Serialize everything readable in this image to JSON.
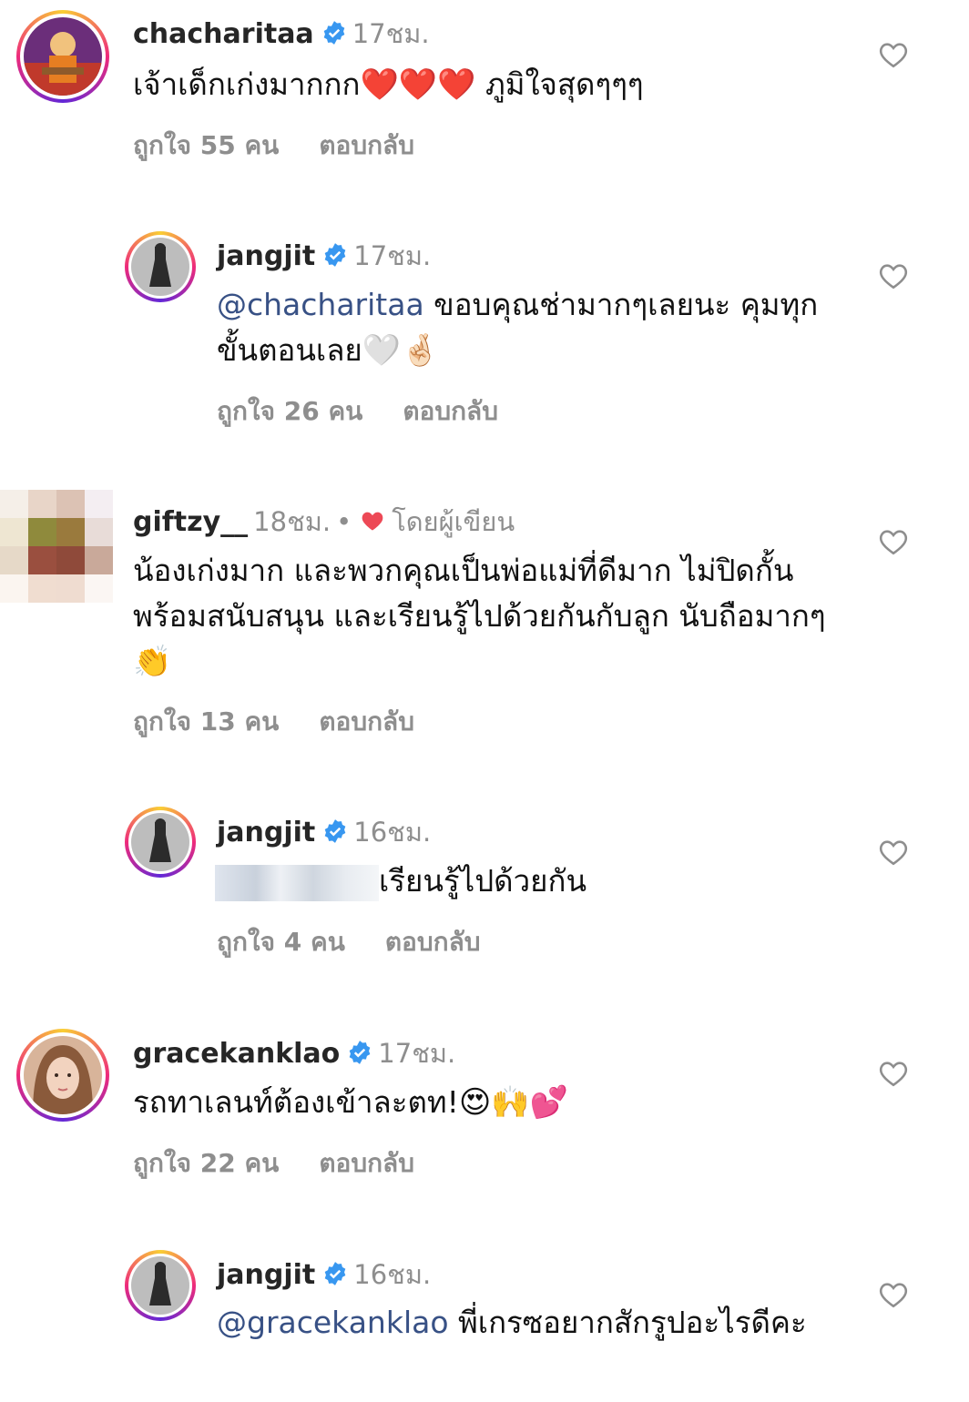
{
  "comments": [
    {
      "user": "chacharitaa",
      "time": "17ชม.",
      "text": "เจ้าเด็กเก่งมากกก",
      "emoji": "❤️❤️❤️",
      "text2": " ภูมิใจสุดๆๆๆ",
      "likes": "ถูกใจ 55 คน",
      "reply": "ตอบกลับ"
    },
    {
      "user": "jangjit",
      "time": "17ชม.",
      "mention": "@chacharitaa",
      "text": " ขอบคุณช่ามากๆเลยนะ คุมทุกขั้นตอนเลย",
      "emoji": "🤍🤞🏻",
      "likes": "ถูกใจ 26 คน",
      "reply": "ตอบกลับ"
    },
    {
      "user": "giftzy__",
      "time": "18ชม.",
      "by_author": "โดยผู้เขียน",
      "text": "น้องเก่งมาก และพวกคุณเป็นพ่อแม่ที่ดีมาก ไม่ปิดกั้นพร้อมสนับสนุน และเรียนรู้ไปด้วยกันกับลูก นับถือมากๆ",
      "emoji": "👏",
      "likes": "ถูกใจ 13 คน",
      "reply": "ตอบกลับ"
    },
    {
      "user": "jangjit",
      "time": "16ชม.",
      "text": "เรียนรู้ไปด้วยกัน",
      "likes": "ถูกใจ 4 คน",
      "reply": "ตอบกลับ"
    },
    {
      "user": "gracekanklao",
      "time": "17ชม.",
      "text": "รถทาเลนท์ต้องเข้าละตท!",
      "emoji": "😍🙌💕",
      "likes": "ถูกใจ 22 คน",
      "reply": "ตอบกลับ"
    },
    {
      "user": "jangjit",
      "time": "16ชม.",
      "mention": "@gracekanklao",
      "text": " พี่เกรซอยากสักรูปอะไรดีคะ"
    }
  ],
  "colors": {
    "accent": "#385185",
    "muted": "#8e8e8e",
    "verified": "#3897f0",
    "heart": "#ed4956"
  }
}
